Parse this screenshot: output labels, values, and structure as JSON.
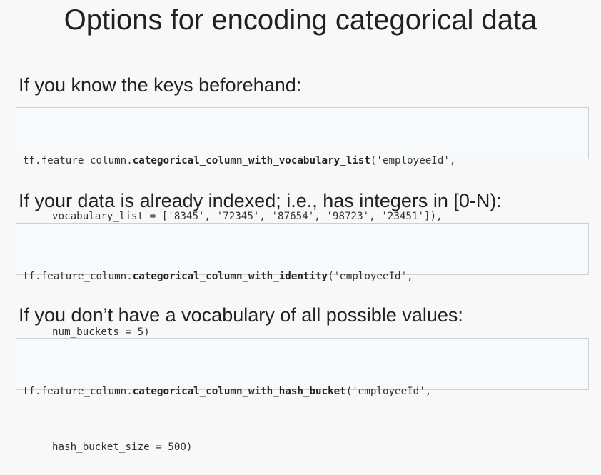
{
  "title": "Options for encoding categorical data",
  "sections": [
    {
      "heading": "If you know the keys beforehand:",
      "code": {
        "prefix": "tf.feature_column.",
        "function": "categorical_column_with_vocabulary_list",
        "args_line1": "('employeeId',",
        "line2": "vocabulary_list = ['8345', '72345', '87654', '98723', '23451']),"
      }
    },
    {
      "heading": "If your data is already indexed; i.e., has integers in [0-N):",
      "code": {
        "prefix": "tf.feature_column.",
        "function": "categorical_column_with_identity",
        "args_line1": "('employeeId',",
        "line2": "num_buckets = 5)"
      }
    },
    {
      "heading": "If you don’t have a vocabulary of all possible values:",
      "code": {
        "prefix": "tf.feature_column.",
        "function": "categorical_column_with_hash_bucket",
        "args_line1": "('employeeId',",
        "line2": "hash_bucket_size = 500)"
      }
    }
  ]
}
